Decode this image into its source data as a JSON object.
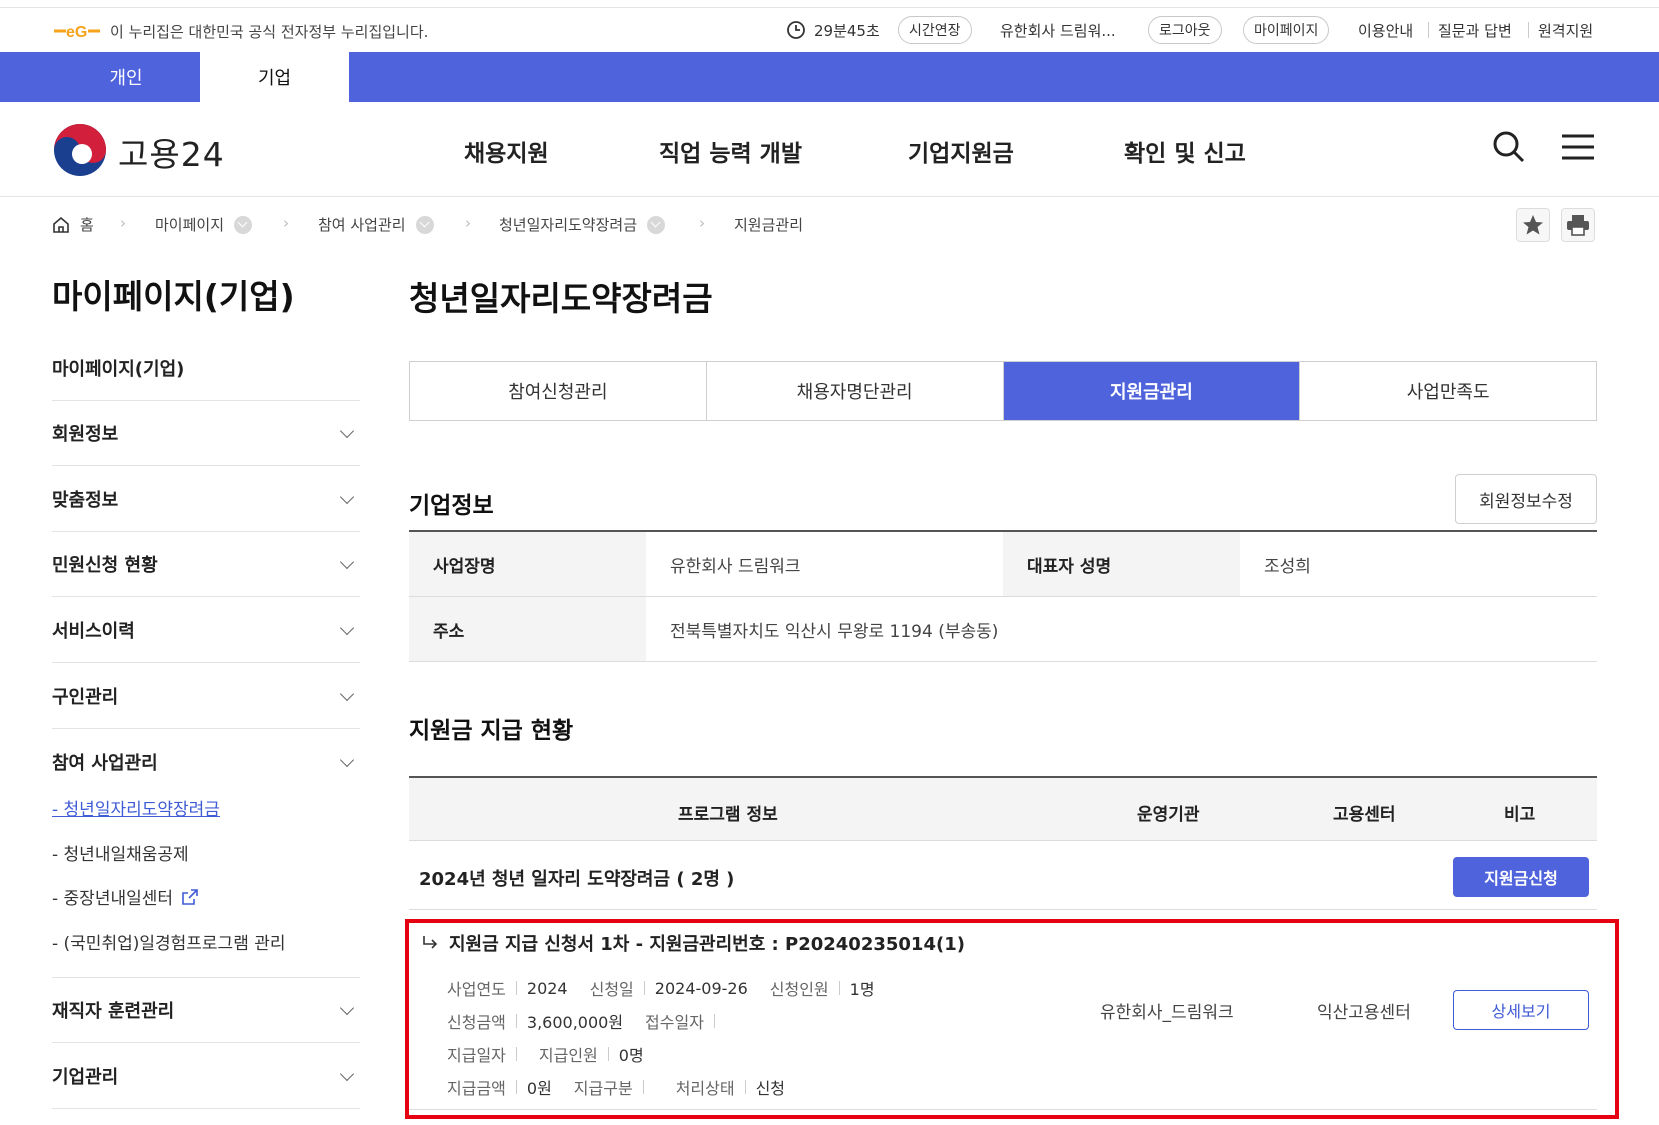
{
  "gov_banner": {
    "text": "이 누리집은 대한민국 공식 전자정부 누리집입니다."
  },
  "utility": {
    "timer": "29분45초",
    "extend": "시간연장",
    "user": "유한회사 드림워...",
    "logout": "로그아웃",
    "mypage": "마이페이지",
    "guide": "이용안내",
    "qna": "질문과 답변",
    "remote": "원격지원"
  },
  "top_tabs": {
    "personal": "개인",
    "business": "기업"
  },
  "header": {
    "logo_text": "고용24",
    "nav": [
      "채용지원",
      "직업 능력 개발",
      "기업지원금",
      "확인 및 신고"
    ]
  },
  "breadcrumb": [
    "홈",
    "마이페이지",
    "참여 사업관리",
    "청년일자리도약장려금",
    "지원금관리"
  ],
  "sidebar": {
    "title": "마이페이지(기업)",
    "items": [
      "마이페이지(기업)",
      "회원정보",
      "맞춤정보",
      "민원신청 현황",
      "서비스이력",
      "구인관리",
      "참여 사업관리"
    ],
    "sub_items": [
      "- 청년일자리도약장려금",
      "- 청년내일채움공제",
      "- 중장년내일센터",
      "- (국민취업)일경험프로그램 관리"
    ],
    "items2": [
      "재직자 훈련관리",
      "기업관리"
    ]
  },
  "main": {
    "title": "청년일자리도약장려금",
    "tabs": [
      "참여신청관리",
      "채용자명단관리",
      "지원금관리",
      "사업만족도"
    ],
    "company_section": "기업정보",
    "edit_button": "회원정보수정",
    "company": {
      "name_label": "사업장명",
      "name": "유한회사 드림워크",
      "ceo_label": "대표자 성명",
      "ceo": "조성희",
      "addr_label": "주소",
      "addr": "전북특별자치도 익산시 무왕로 1194 (부송동)"
    },
    "payment_section": "지원금 지급 현황",
    "columns": [
      "프로그램 정보",
      "운영기관",
      "고용센터",
      "비고"
    ],
    "program_title": "2024년 청년 일자리 도약장려금 ( 2명 )",
    "apply_button": "지원금신청",
    "detail": {
      "title": "지원금 지급 신청서 1차 - 지원금관리번호 : P20240235014(1)",
      "year_label": "사업연도",
      "year": "2024",
      "apply_date_label": "신청일",
      "apply_date": "2024-09-26",
      "apply_people_label": "신청인원",
      "apply_people": "1명",
      "apply_amount_label": "신청금액",
      "apply_amount": "3,600,000원",
      "receipt_label": "접수일자",
      "receipt": "",
      "pay_date_label": "지급일자",
      "pay_date": "",
      "pay_people_label": "지급인원",
      "pay_people": "0명",
      "pay_amount_label": "지급금액",
      "pay_amount": "0원",
      "pay_type_label": "지급구분",
      "pay_type": "",
      "status_label": "처리상태",
      "status": "신청",
      "org": "유한회사_드림워크",
      "center": "익산고용센터",
      "view_button": "상세보기"
    }
  },
  "colors": {
    "primary": "#4f63dd",
    "highlight": "#e50012"
  }
}
